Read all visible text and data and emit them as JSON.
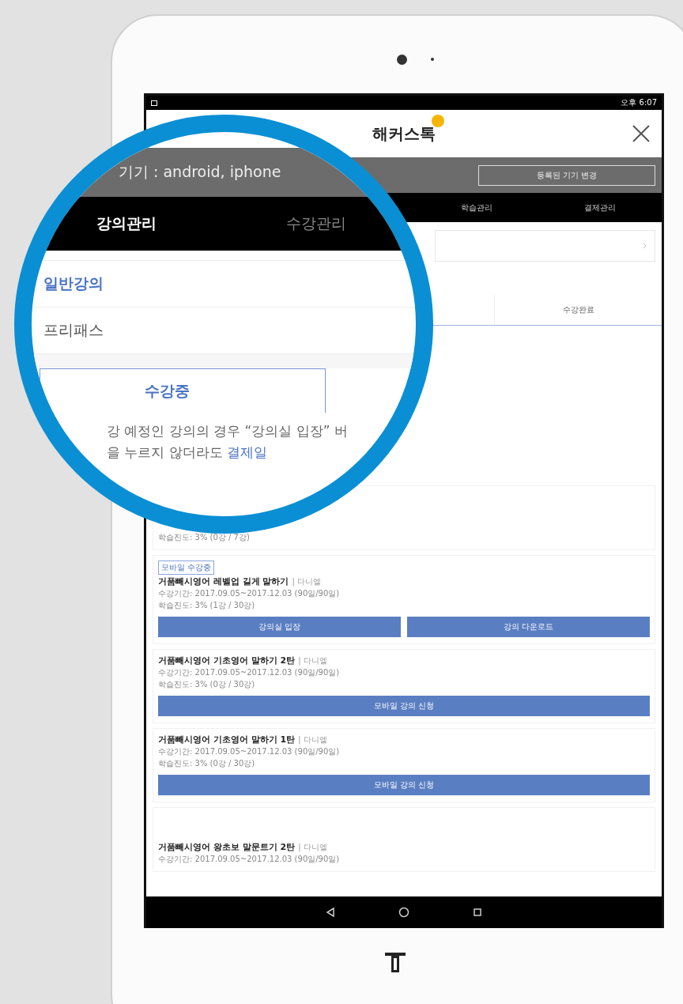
{
  "status_bar": {
    "time": "오후 6:07"
  },
  "header": {
    "logo": "해커스톡"
  },
  "device_bar": {
    "button": "등록된 기기 변경"
  },
  "nav": [
    {
      "label": "학습관리"
    },
    {
      "label": "결제관리"
    }
  ],
  "sub_tabs": [
    {
      "label": "수강완료"
    }
  ],
  "courses": [
    {
      "lines": [
        "학습진도: 3% (0강 / 7강)"
      ]
    },
    {
      "badge": "모바일 수강중",
      "title": "거품빼시영어 레벨업 길게 말하기",
      "instructor": "| 다니엘",
      "lines": [
        "수강기간: 2017.09.05~2017.12.03 (90일/90일)",
        "학습진도: 3% (1강 / 30강)"
      ],
      "buttons": [
        "강의실 입장",
        "강의 다운로드"
      ]
    },
    {
      "title": "거품빼시영어 기초영어 말하기 2탄",
      "instructor": "| 다니엘",
      "lines": [
        "수강기간: 2017.09.05~2017.12.03 (90일/90일)",
        "학습진도: 3% (0강 / 30강)"
      ],
      "buttons": [
        "모바일 강의 신청"
      ]
    },
    {
      "title": "거품빼시영어 기초영어 말하기 1탄",
      "instructor": "| 다니엘",
      "lines": [
        "수강기간: 2017.09.05~2017.12.03 (90일/90일)",
        "학습진도: 3% (0강 / 30강)"
      ],
      "buttons": [
        "모바일 강의 신청"
      ]
    },
    {
      "title": "거품빼시영어 왕초보 말문트기 2탄",
      "instructor": "| 다니엘",
      "lines": [
        "수강기간: 2017.09.05~2017.12.03 (90일/90일)"
      ]
    }
  ],
  "magnifier": {
    "device_info": "기기 : android, iphone",
    "tabs": [
      {
        "label": "강의관리",
        "selected": true
      },
      {
        "label": "수강관리",
        "selected": false
      }
    ],
    "menu": [
      {
        "label": "일반강의",
        "selected": true
      },
      {
        "label": "프리패스",
        "selected": false
      }
    ],
    "tab": {
      "label": "수강중",
      "selected": true
    },
    "notice": [
      {
        "text": "강 예정인 강의의 경우 “강의실 입장” 버"
      },
      {
        "text": "을 누르지 않더라도 ",
        "link": "결제일"
      }
    ]
  }
}
